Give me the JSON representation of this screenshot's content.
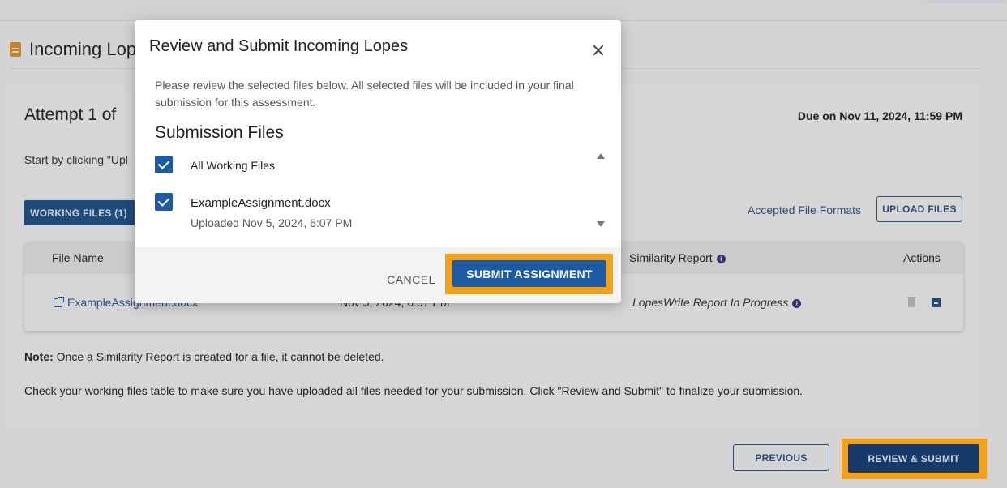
{
  "page": {
    "title": "Incoming Lopes",
    "attempt_label": "Attempt 1 of",
    "due_label": "Due on Nov 11, 2024, 11:59 PM",
    "start_text": "Start by clicking \"Upl",
    "tab_working": "WORKING FILES (1)",
    "accepted_formats": "Accepted File Formats",
    "upload_button": "UPLOAD FILES"
  },
  "table": {
    "headers": {
      "file_name": "File Name",
      "similarity_report": "Similarity Report",
      "actions": "Actions"
    },
    "row": {
      "file_name": "ExampleAssignment.docx",
      "uploaded": "Nov 5, 2024, 6:07 PM",
      "report_status": "LopesWrite Report In Progress"
    }
  },
  "notes": {
    "note_label": "Note:",
    "note_text": " Once a Similarity Report is created for a file, it cannot be deleted.",
    "check_text": "Check your working files table to make sure you have uploaded all files needed for your submission. Click \"Review and Submit\" to finalize your submission."
  },
  "footer": {
    "previous_button": "PREVIOUS",
    "review_submit_button": "REVIEW & SUBMIT"
  },
  "modal": {
    "title": "Review and Submit Incoming Lopes",
    "description": "Please review the selected files below. All selected files will be included in your final submission for this assessment.",
    "section_title": "Submission Files",
    "all_working_files": "All Working Files",
    "file_name": "ExampleAssignment.docx",
    "file_uploaded": "Uploaded Nov 5, 2024, 6:07 PM",
    "cancel_button": "CANCEL",
    "submit_button": "SUBMIT ASSIGNMENT"
  },
  "colors": {
    "highlight": "#f5a015",
    "primary": "#1c5aa3",
    "navy": "#163a6a"
  }
}
